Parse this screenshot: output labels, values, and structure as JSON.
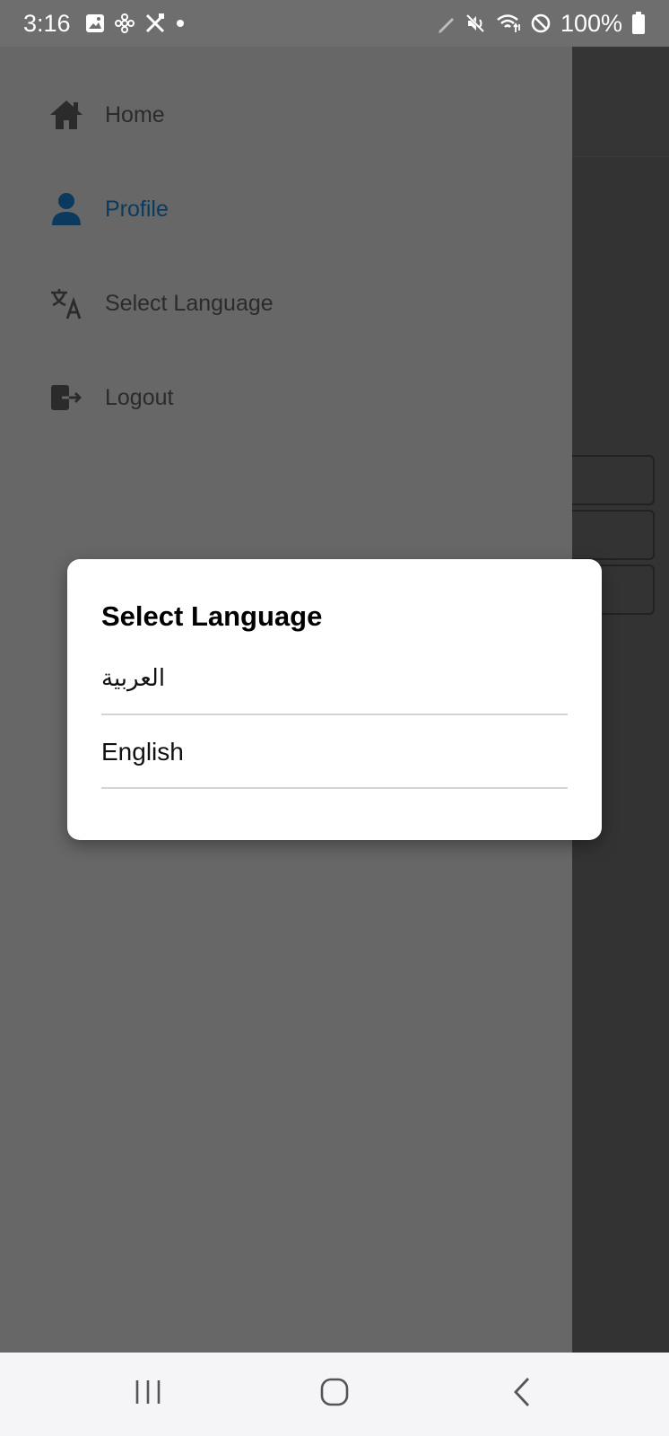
{
  "status_bar": {
    "time": "3:16",
    "battery": "100%",
    "left_icons": [
      "gallery-icon",
      "fan-icon",
      "tools-icon",
      "dot-icon"
    ],
    "right_icons": [
      "pen-icon",
      "mute-icon",
      "wifi-icon",
      "block-icon",
      "battery-icon"
    ]
  },
  "drawer": {
    "items": [
      {
        "label": "Home",
        "icon": "home-icon"
      },
      {
        "label": "Profile",
        "icon": "person-icon",
        "active": true
      },
      {
        "label": "Select Language",
        "icon": "translate-icon"
      },
      {
        "label": "Logout",
        "icon": "logout-icon"
      }
    ],
    "active_color": "#0b3a5e"
  },
  "dialog": {
    "title": "Select Language",
    "options": [
      {
        "label": "العربية"
      },
      {
        "label": "English"
      }
    ]
  },
  "nav_bar": {
    "buttons": [
      "recent-apps-icon",
      "home-nav-icon",
      "back-icon"
    ]
  }
}
